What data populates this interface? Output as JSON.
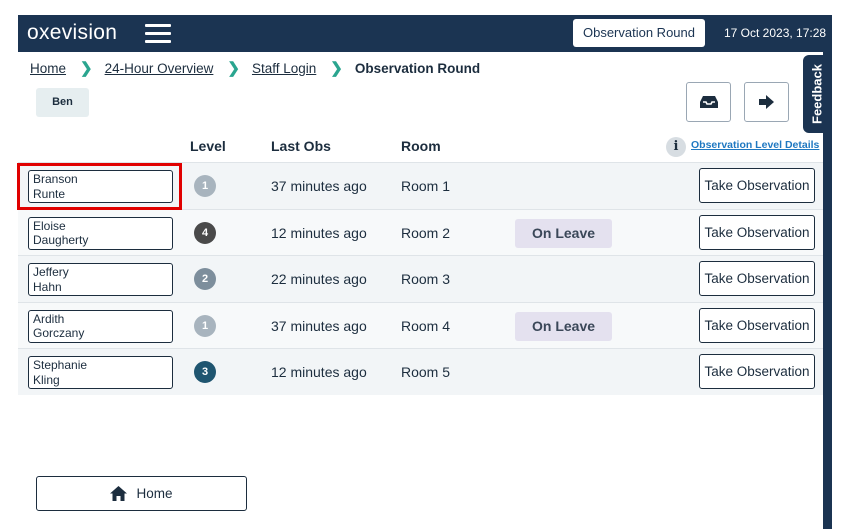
{
  "header": {
    "logo": "oxevision",
    "round_button": "Observation Round",
    "datetime": "17 Oct 2023, 17:28"
  },
  "feedback": "Feedback",
  "breadcrumb": [
    {
      "label": "Home"
    },
    {
      "label": "24-Hour Overview"
    },
    {
      "label": "Staff Login"
    },
    {
      "label": "Observation Round"
    }
  ],
  "user": "Ben",
  "table": {
    "columns": [
      "Level",
      "Last Obs",
      "Room"
    ],
    "level_details_link": "Observation Level Details",
    "rows": [
      {
        "first": "Branson",
        "last": "Runte",
        "level": "1",
        "level_color": "#a8b4be",
        "last_obs": "37 minutes ago",
        "room": "Room 1",
        "status": "",
        "action": "Take Observation"
      },
      {
        "first": "Eloise",
        "last": "Daugherty",
        "level": "4",
        "level_color": "#4a4a4a",
        "last_obs": "12 minutes ago",
        "room": "Room 2",
        "status": "On Leave",
        "action": "Take Observation"
      },
      {
        "first": "Jeffery",
        "last": "Hahn",
        "level": "2",
        "level_color": "#7d8e9c",
        "last_obs": "22 minutes ago",
        "room": "Room 3",
        "status": "",
        "action": "Take Observation"
      },
      {
        "first": "Ardith",
        "last": "Gorczany",
        "level": "1",
        "level_color": "#a8b4be",
        "last_obs": "37 minutes ago",
        "room": "Room 4",
        "status": "On Leave",
        "action": "Take Observation"
      },
      {
        "first": "Stephanie",
        "last": "Kling",
        "level": "3",
        "level_color": "#1f5570",
        "last_obs": "12 minutes ago",
        "room": "Room 5",
        "status": "",
        "action": "Take Observation"
      }
    ]
  },
  "footer": {
    "home_button": "Home"
  },
  "colors": {
    "navy": "#1b3452",
    "accent": "#2aa58f",
    "highlight": "#e00000"
  }
}
